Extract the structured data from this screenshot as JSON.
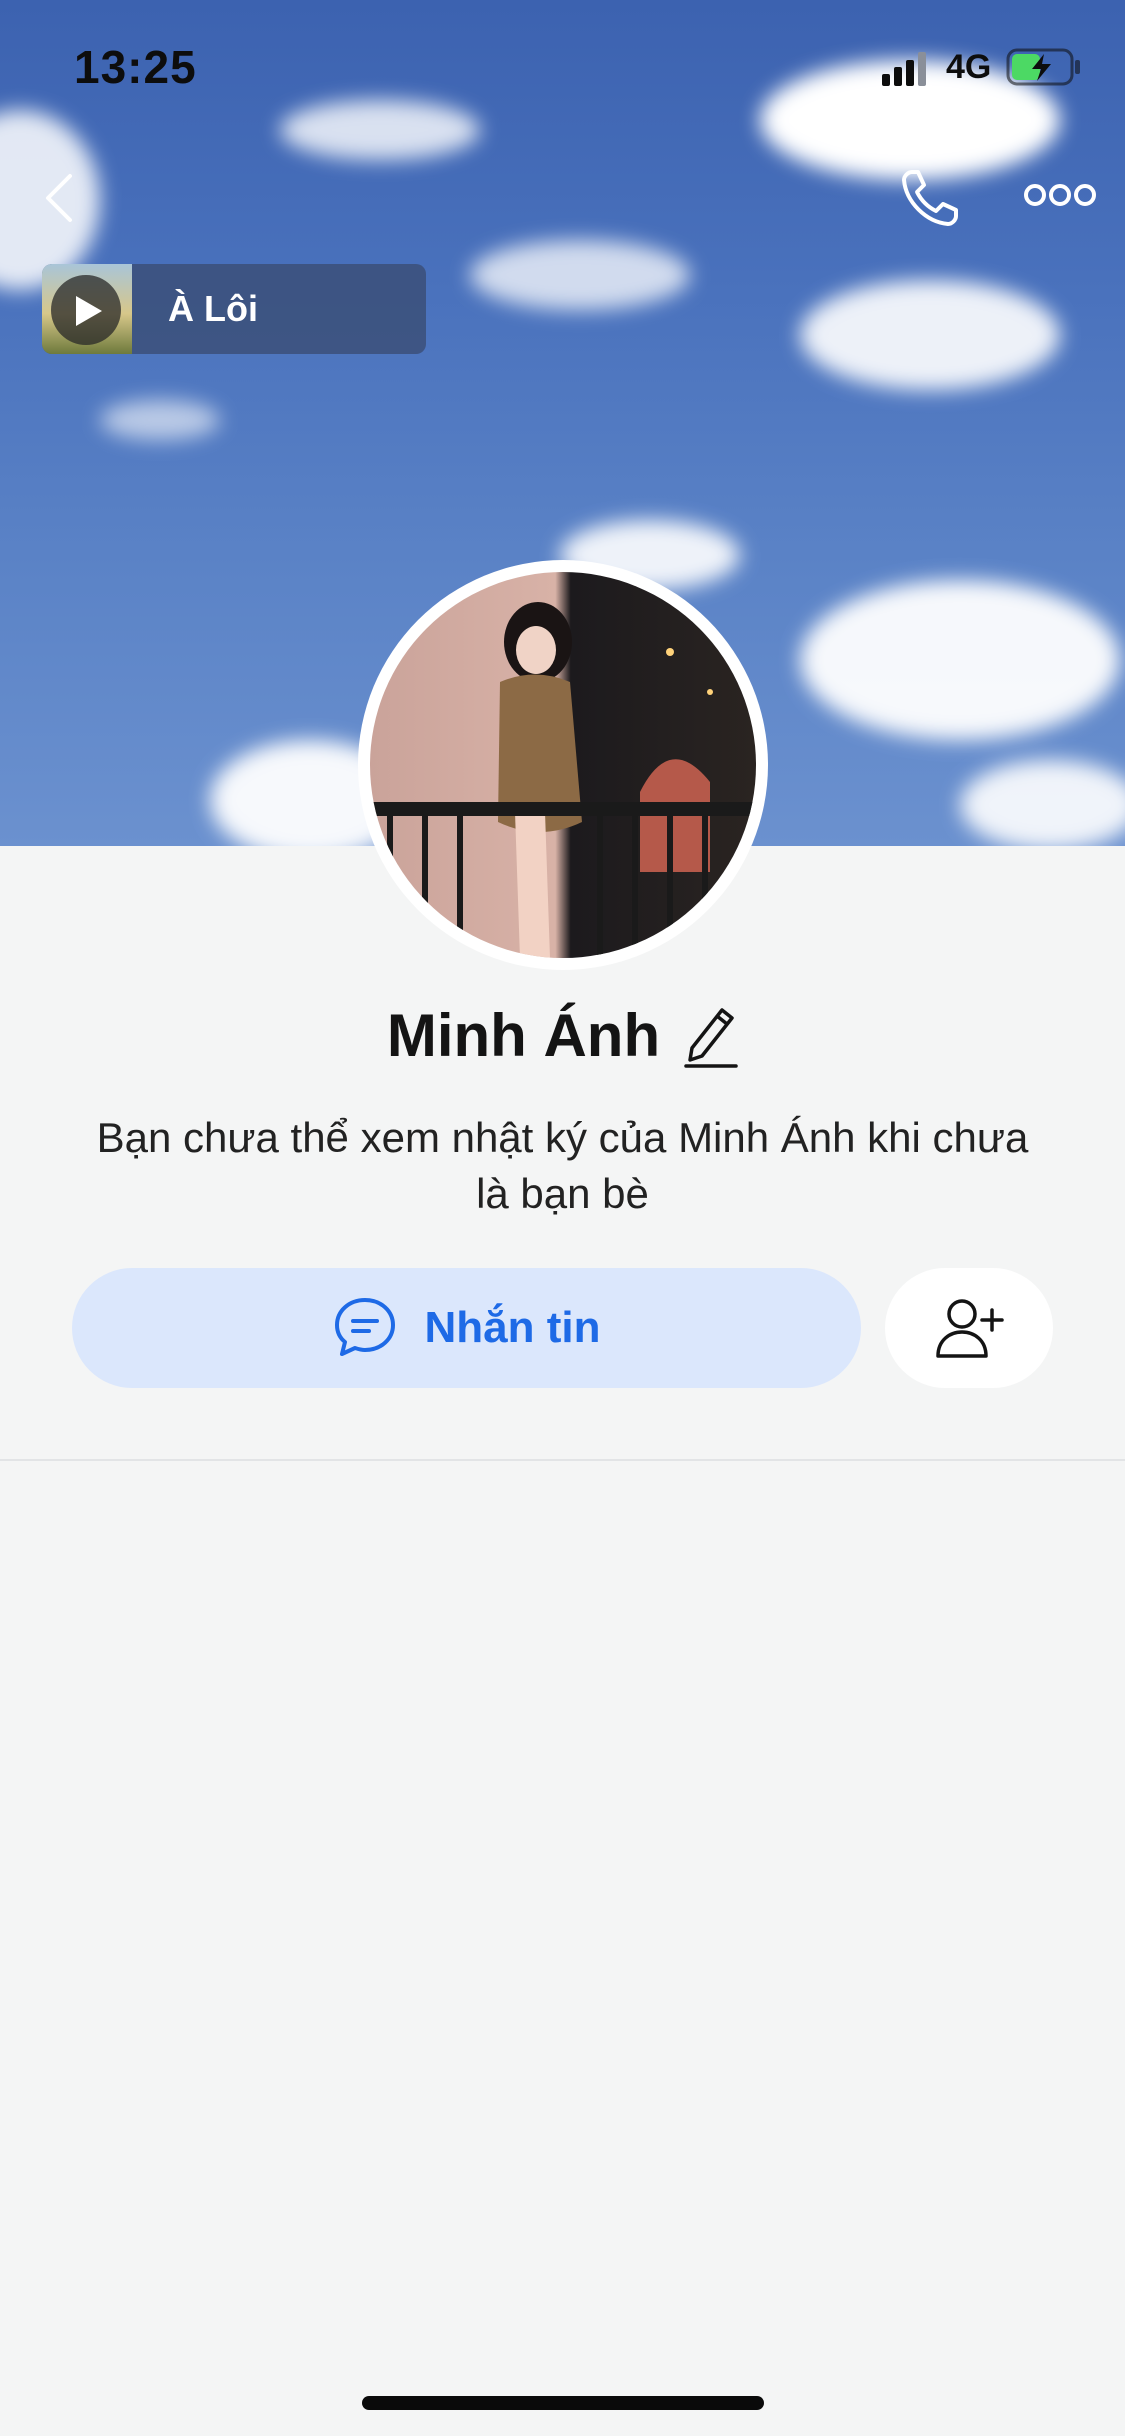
{
  "status_bar": {
    "time": "13:25",
    "network": "4G",
    "battery_level": 0.5,
    "signal_icon": "signal-bars-icon",
    "battery_icon": "battery-charging-icon"
  },
  "header": {
    "back_icon": "chevron-left-icon",
    "call_icon": "phone-icon",
    "more_icon": "ellipsis-icon"
  },
  "music": {
    "title": "À Lôi",
    "play_icon": "play-icon"
  },
  "profile": {
    "name": "Minh Ánh",
    "edit_icon": "pencil-icon",
    "notice": "Bạn chưa thể xem nhật ký của Minh Ánh khi chưa là bạn bè"
  },
  "actions": {
    "chat_label": "Nhắn tin",
    "chat_icon": "chat-bubble-icon",
    "add_friend_icon": "add-user-icon"
  },
  "colors": {
    "accent": "#1e6ae6",
    "chat_button_bg": "#dbe7fc",
    "page_bg": "#f4f5f5",
    "cover_sky": "#4a72bd"
  }
}
